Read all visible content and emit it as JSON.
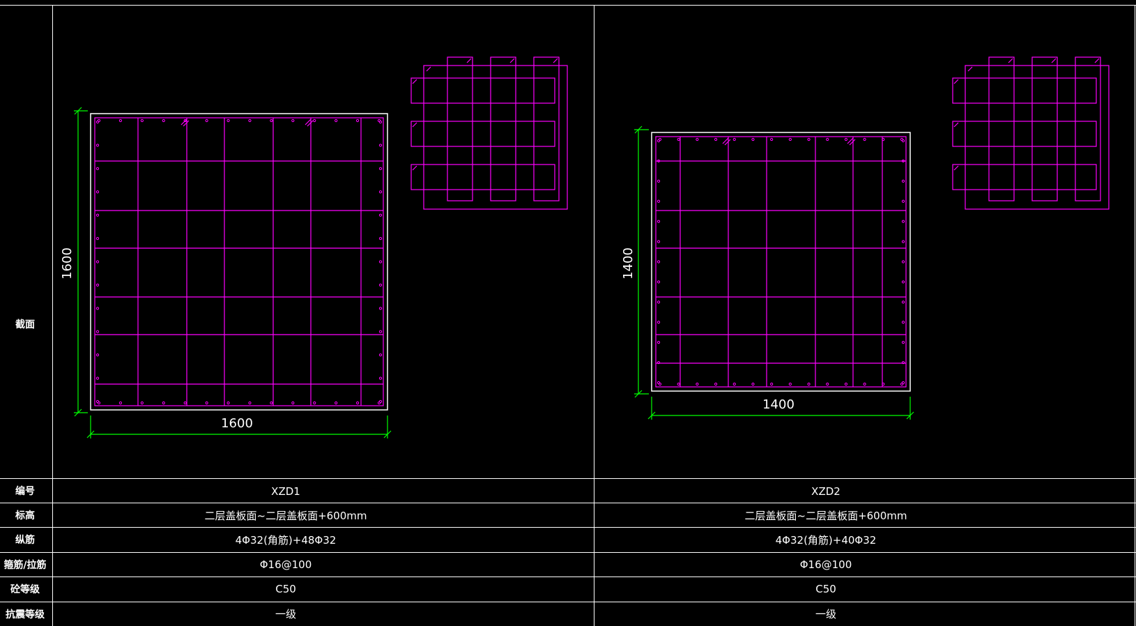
{
  "colors": {
    "background": "#000000",
    "grid": "#ffffff",
    "rebar": "#ff00ff",
    "dimension": "#00ff00",
    "text": "#ffffff"
  },
  "table": {
    "row_headers": {
      "section": "截面",
      "id": "编号",
      "elevation": "标高",
      "longitudinal": "纵筋",
      "stirrup": "箍筋/拉筋",
      "concrete": "砼等级",
      "seismic": "抗震等级"
    },
    "columns": [
      {
        "id": "XZD1",
        "elevation": "二层盖板面~二层盖板面+600mm",
        "longitudinal": "4Φ32(角筋)+48Φ32",
        "stirrup": "Φ16@100",
        "concrete": "C50",
        "seismic": "一级",
        "section": {
          "width_label": "1600",
          "height_label": "1600"
        }
      },
      {
        "id": "XZD2",
        "elevation": "二层盖板面~二层盖板面+600mm",
        "longitudinal": "4Φ32(角筋)+40Φ32",
        "stirrup": "Φ16@100",
        "concrete": "C50",
        "seismic": "一级",
        "section": {
          "width_label": "1400",
          "height_label": "1400"
        }
      }
    ]
  }
}
